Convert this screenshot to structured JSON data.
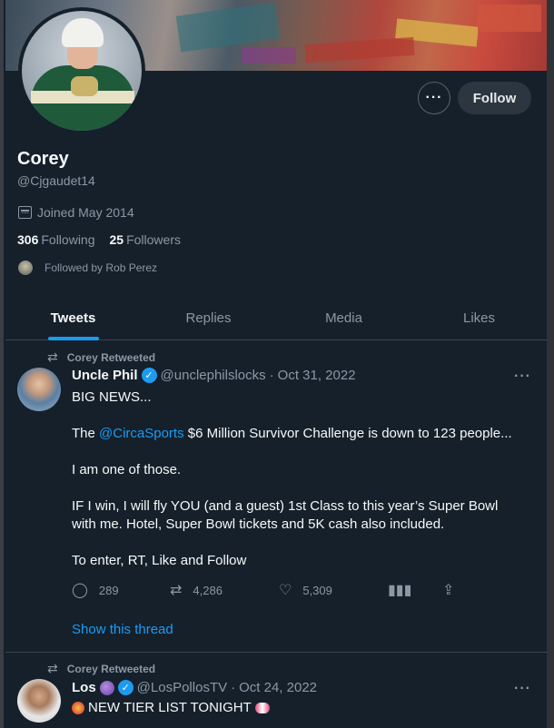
{
  "profile": {
    "name": "Corey",
    "handle": "@Cjgaudet14",
    "joined": "Joined May 2014",
    "following_count": "306",
    "following_label": "Following",
    "followers_count": "25",
    "followers_label": "Followers",
    "followed_by": "Followed by Rob Perez",
    "follow_label": "Follow",
    "more_label": "···"
  },
  "tabs": [
    {
      "label": "Tweets",
      "active": true
    },
    {
      "label": "Replies",
      "active": false
    },
    {
      "label": "Media",
      "active": false
    },
    {
      "label": "Likes",
      "active": false
    }
  ],
  "tweets": [
    {
      "retweeted_by": "Corey Retweeted",
      "author": "Uncle Phil",
      "handle": "@unclephilslocks",
      "date": "Oct 31, 2022",
      "body_line1": "BIG NEWS...",
      "body_pre": "The ",
      "body_mention": "@CircaSports",
      "body_post": " $6 Million Survivor Challenge is down to 123 people...",
      "body_line3": "I am one of those.",
      "body_line4": "IF I win, I will fly YOU (and a guest) 1st Class to this year’s Super Bowl with me. Hotel, Super Bowl tickets and 5K cash also included.",
      "body_line5": "To enter, RT, Like and Follow",
      "replies": "289",
      "retweets": "4,286",
      "likes": "5,309",
      "show_thread": "Show this thread"
    },
    {
      "retweeted_by": "Corey Retweeted",
      "author": "Los",
      "handle": "@LosPollosTV",
      "date": "Oct 24, 2022",
      "body_line1": "NEW TIER LIST TONIGHT"
    }
  ],
  "icons": {
    "retweet": "retweet-icon",
    "reply": "reply-icon",
    "like": "heart-icon",
    "analytics": "analytics-icon",
    "share": "share-icon",
    "verified": "verified-icon",
    "calendar": "calendar-icon"
  },
  "colors": {
    "background": "#15202b",
    "accent": "#1d9bf0",
    "muted": "#8b98a5"
  }
}
